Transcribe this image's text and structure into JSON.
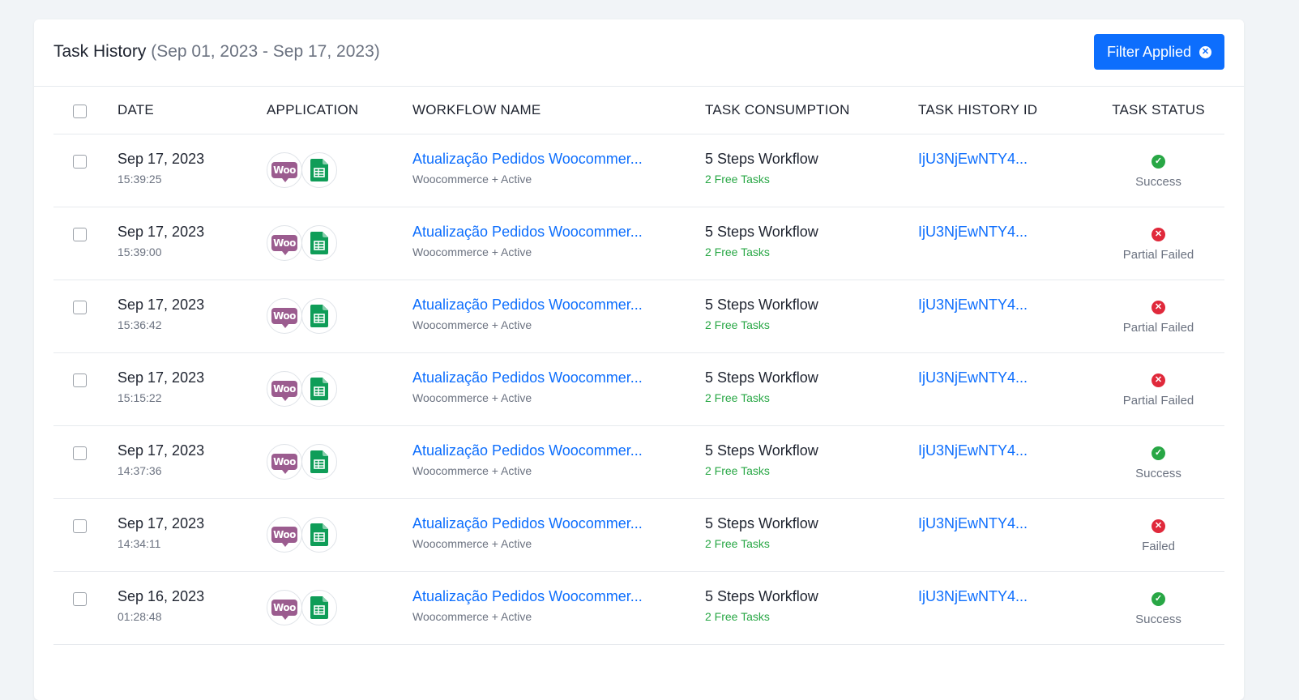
{
  "header": {
    "title": "Task History",
    "date_range": "(Sep 01, 2023 - Sep 17, 2023)",
    "filter_button": "Filter Applied"
  },
  "table": {
    "columns": [
      "DATE",
      "APPLICATION",
      "WORKFLOW NAME",
      "TASK CONSUMPTION",
      "TASK HISTORY ID",
      "TASK STATUS"
    ],
    "rows": [
      {
        "date": "Sep 17, 2023",
        "time": "15:39:25",
        "workflow": "Atualização Pedidos Woocommer...",
        "workflow_sub": "Woocommerce + Active",
        "consumption": "5 Steps Workflow",
        "free_tasks": "2 Free Tasks",
        "history_id": "IjU3NjEwNTY4...",
        "status": "Success",
        "status_type": "success"
      },
      {
        "date": "Sep 17, 2023",
        "time": "15:39:00",
        "workflow": "Atualização Pedidos Woocommer...",
        "workflow_sub": "Woocommerce + Active",
        "consumption": "5 Steps Workflow",
        "free_tasks": "2 Free Tasks",
        "history_id": "IjU3NjEwNTY4...",
        "status": "Partial Failed",
        "status_type": "failed"
      },
      {
        "date": "Sep 17, 2023",
        "time": "15:36:42",
        "workflow": "Atualização Pedidos Woocommer...",
        "workflow_sub": "Woocommerce + Active",
        "consumption": "5 Steps Workflow",
        "free_tasks": "2 Free Tasks",
        "history_id": "IjU3NjEwNTY4...",
        "status": "Partial Failed",
        "status_type": "failed"
      },
      {
        "date": "Sep 17, 2023",
        "time": "15:15:22",
        "workflow": "Atualização Pedidos Woocommer...",
        "workflow_sub": "Woocommerce + Active",
        "consumption": "5 Steps Workflow",
        "free_tasks": "2 Free Tasks",
        "history_id": "IjU3NjEwNTY4...",
        "status": "Partial Failed",
        "status_type": "failed"
      },
      {
        "date": "Sep 17, 2023",
        "time": "14:37:36",
        "workflow": "Atualização Pedidos Woocommer...",
        "workflow_sub": "Woocommerce + Active",
        "consumption": "5 Steps Workflow",
        "free_tasks": "2 Free Tasks",
        "history_id": "IjU3NjEwNTY4...",
        "status": "Success",
        "status_type": "success"
      },
      {
        "date": "Sep 17, 2023",
        "time": "14:34:11",
        "workflow": "Atualização Pedidos Woocommer...",
        "workflow_sub": "Woocommerce + Active",
        "consumption": "5 Steps Workflow",
        "free_tasks": "2 Free Tasks",
        "history_id": "IjU3NjEwNTY4...",
        "status": "Failed",
        "status_type": "failed"
      },
      {
        "date": "Sep 16, 2023",
        "time": "01:28:48",
        "workflow": "Atualização Pedidos Woocommer...",
        "workflow_sub": "Woocommerce + Active",
        "consumption": "5 Steps Workflow",
        "free_tasks": "2 Free Tasks",
        "history_id": "IjU3NjEwNTY4...",
        "status": "Success",
        "status_type": "success"
      }
    ]
  },
  "icons": {
    "app_1": "woocommerce-icon",
    "app_2": "google-sheets-icon",
    "success": "check-circle-icon",
    "failed": "x-circle-icon",
    "filter_clear": "x-circle-icon"
  },
  "colors": {
    "primary": "#0d6efd",
    "success": "#28a745",
    "danger": "#e0293b",
    "woo": "#9b5c8f",
    "sheets": "#0f9d58"
  }
}
